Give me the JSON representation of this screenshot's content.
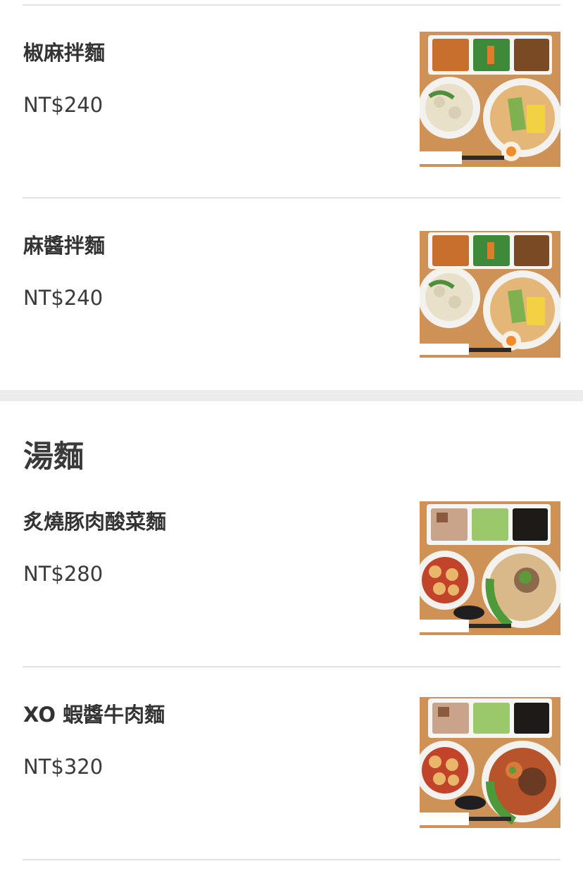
{
  "sections": [
    {
      "items": [
        {
          "name": "椒麻拌麵",
          "price": "NT$240",
          "photo_icon": "noodle-set-meal-photo"
        },
        {
          "name": "麻醬拌麵",
          "price": "NT$240",
          "photo_icon": "noodle-set-meal-photo"
        }
      ]
    },
    {
      "title": "湯麵",
      "items": [
        {
          "name": "炙燒豚肉酸菜麵",
          "price": "NT$280",
          "photo_icon": "soup-noodle-set-meal-photo"
        },
        {
          "name": "XO 蝦醬牛肉麵",
          "price": "NT$320",
          "photo_icon": "beef-noodle-set-meal-photo"
        }
      ]
    }
  ],
  "colors": {
    "text": "#333333",
    "divider": "#e2e2e2",
    "section_gap": "#ececec",
    "tray_wood": "#c98a4e"
  }
}
